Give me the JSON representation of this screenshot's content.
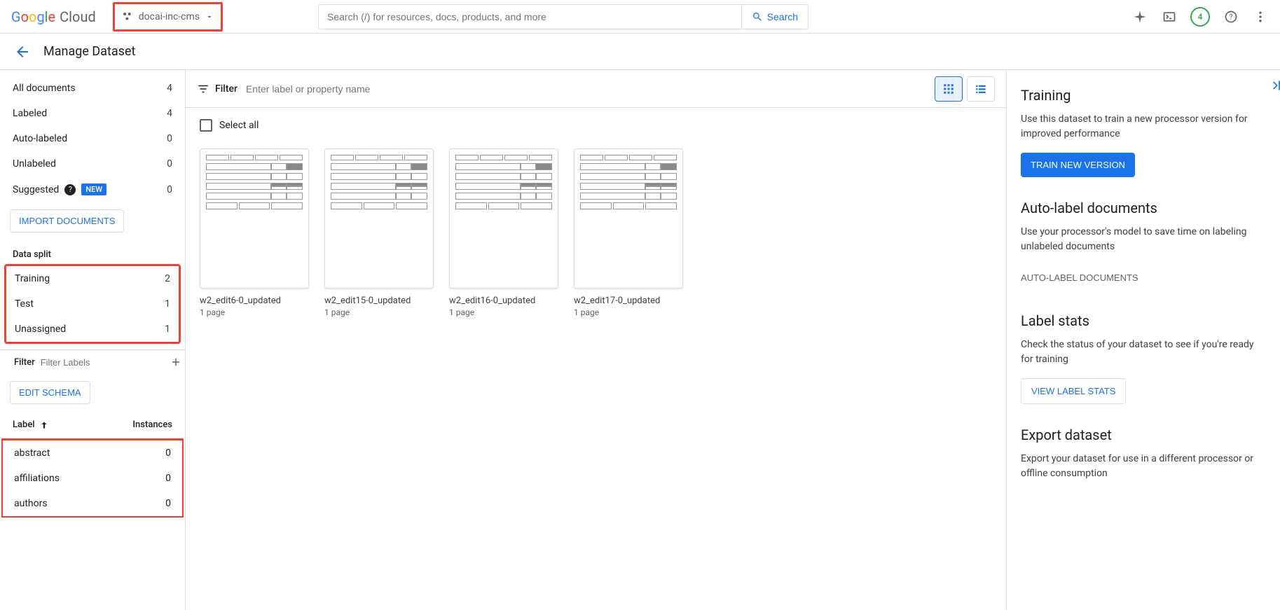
{
  "header": {
    "logo_cloud": "Cloud",
    "project": "docai-inc-cms",
    "search_placeholder": "Search (/) for resources, docs, products, and more",
    "search_button": "Search",
    "notification_count": "4"
  },
  "subheader": {
    "title": "Manage Dataset"
  },
  "sidebar": {
    "doc_sections": [
      {
        "label": "All documents",
        "count": "4"
      },
      {
        "label": "Labeled",
        "count": "4"
      },
      {
        "label": "Auto-labeled",
        "count": "0"
      },
      {
        "label": "Unlabeled",
        "count": "0"
      }
    ],
    "suggested": {
      "label": "Suggested",
      "new_badge": "NEW",
      "count": "0"
    },
    "import_button": "IMPORT DOCUMENTS",
    "data_split_label": "Data split",
    "data_split": [
      {
        "label": "Training",
        "count": "2"
      },
      {
        "label": "Test",
        "count": "1"
      },
      {
        "label": "Unassigned",
        "count": "1"
      }
    ],
    "filter_label": "Filter",
    "filter_placeholder": "Filter Labels",
    "edit_schema_button": "EDIT SCHEMA",
    "label_header": {
      "label": "Label",
      "instances": "Instances"
    },
    "labels": [
      {
        "label": "abstract",
        "count": "0"
      },
      {
        "label": "affiliations",
        "count": "0"
      },
      {
        "label": "authors",
        "count": "0"
      }
    ]
  },
  "main": {
    "filter_label": "Filter",
    "filter_placeholder": "Enter label or property name",
    "select_all": "Select all",
    "documents": [
      {
        "name": "w2_edit6-0_updated",
        "pages": "1 page"
      },
      {
        "name": "w2_edit15-0_updated",
        "pages": "1 page"
      },
      {
        "name": "w2_edit16-0_updated",
        "pages": "1 page"
      },
      {
        "name": "w2_edit17-0_updated",
        "pages": "1 page"
      }
    ]
  },
  "right": {
    "training": {
      "heading": "Training",
      "text": "Use this dataset to train a new processor version for improved performance",
      "button": "TRAIN NEW VERSION"
    },
    "autolabel": {
      "heading": "Auto-label documents",
      "text": "Use your processor's model to save time on labeling unlabeled documents",
      "button": "AUTO-LABEL DOCUMENTS"
    },
    "stats": {
      "heading": "Label stats",
      "text": "Check the status of your dataset to see if you're ready for training",
      "button": "VIEW LABEL STATS"
    },
    "export": {
      "heading": "Export dataset",
      "text": "Export your dataset for use in a different processor or offline consumption"
    }
  }
}
